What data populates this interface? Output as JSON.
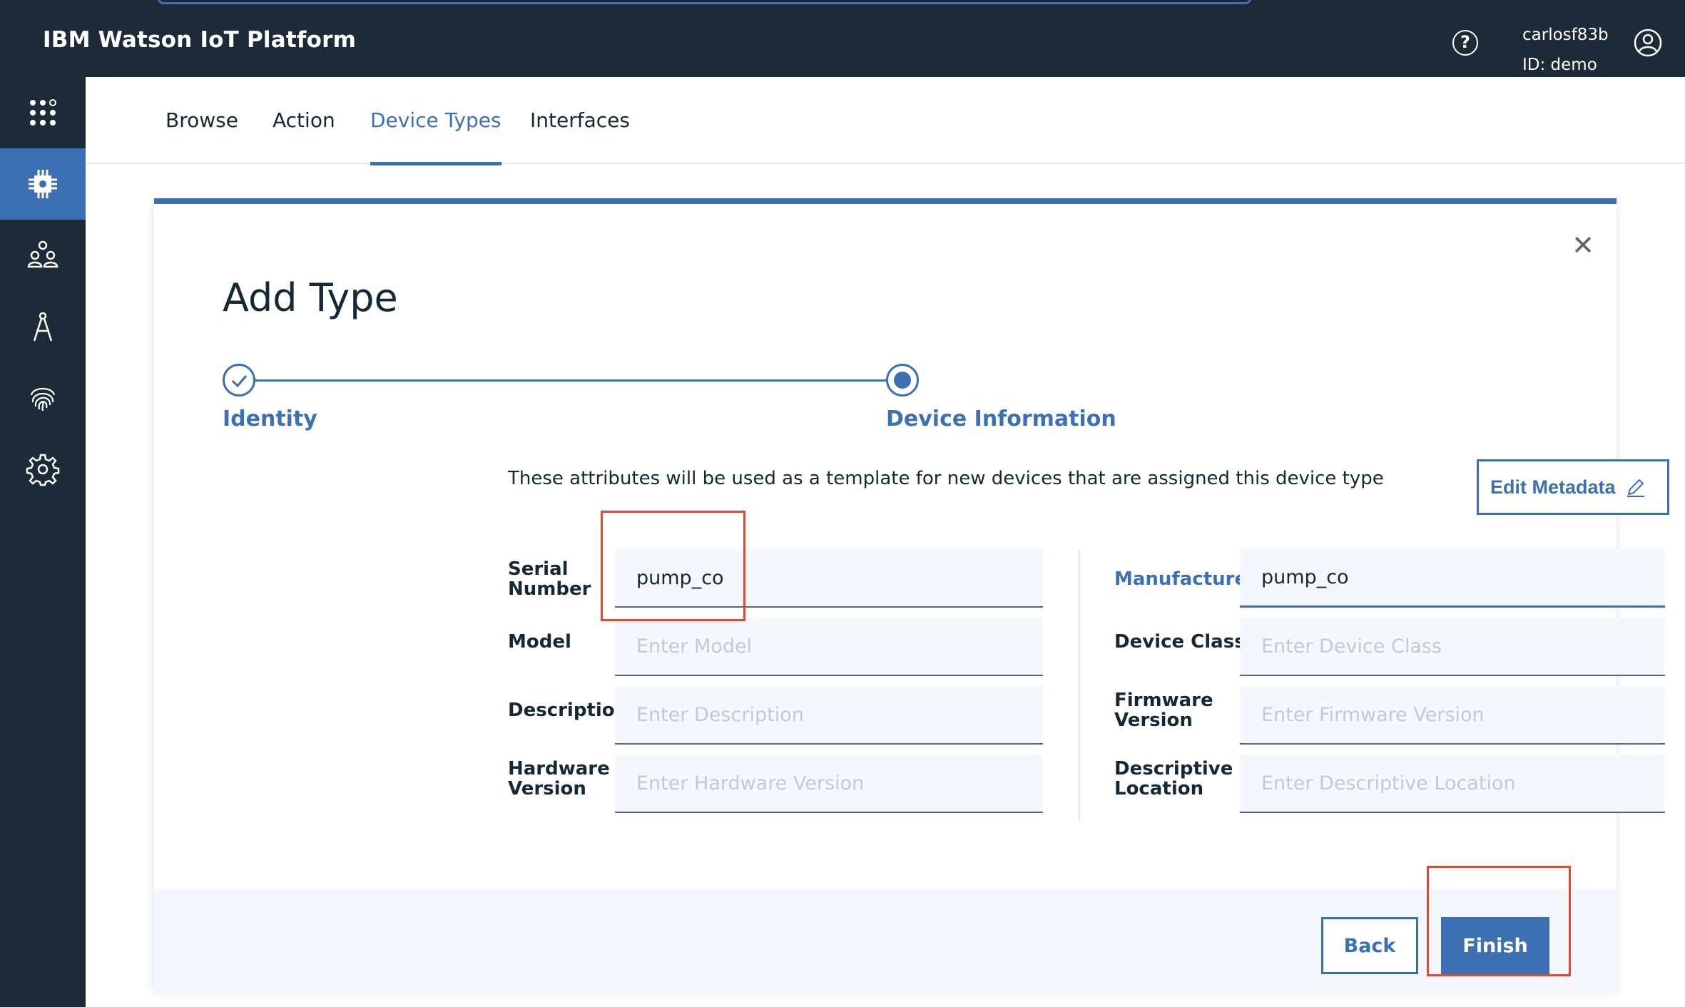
{
  "header": {
    "app_title": "IBM Watson IoT Platform",
    "help_icon": "question-circle-icon",
    "username": "carlosf83b",
    "org_id": "ID: demo",
    "user_icon": "user-circle-icon"
  },
  "rail": {
    "items": [
      {
        "icon": "app-grid-icon",
        "active": false
      },
      {
        "icon": "chip-icon",
        "active": true
      },
      {
        "icon": "members-icon",
        "active": false
      },
      {
        "icon": "compass-icon",
        "active": false
      },
      {
        "icon": "fingerprint-icon",
        "active": false
      },
      {
        "icon": "gear-icon",
        "active": false
      }
    ]
  },
  "tabs": [
    {
      "label": "Browse",
      "active": false
    },
    {
      "label": "Action",
      "active": false
    },
    {
      "label": "Device Types",
      "active": true
    },
    {
      "label": "Interfaces",
      "active": false
    }
  ],
  "modal": {
    "title": "Add Type",
    "close_glyph": "✕",
    "steps": [
      {
        "label": "Identity",
        "state": "complete"
      },
      {
        "label": "Device Information",
        "state": "current"
      }
    ],
    "helper_text": "These attributes will be used as a template for new devices that are assigned this device type",
    "edit_metadata_label": "Edit Metadata",
    "fields_left": [
      {
        "label_line1": "Serial",
        "label_line2": "Number",
        "value": "pump_co",
        "placeholder": ""
      },
      {
        "label_line1": "Model",
        "label_line2": "",
        "value": "",
        "placeholder": "Enter Model"
      },
      {
        "label_line1": "Description",
        "label_line2": "",
        "value": "",
        "placeholder": "Enter Description"
      },
      {
        "label_line1": "Hardware",
        "label_line2": "Version",
        "value": "",
        "placeholder": "Enter Hardware Version"
      }
    ],
    "fields_right": [
      {
        "label_line1": "Manufacturer",
        "label_line2": "",
        "value": "pump_co",
        "placeholder": ""
      },
      {
        "label_line1": "Device Class",
        "label_line2": "",
        "value": "",
        "placeholder": "Enter Device Class"
      },
      {
        "label_line1": "Firmware",
        "label_line2": "Version",
        "value": "",
        "placeholder": "Enter Firmware Version"
      },
      {
        "label_line1": "Descriptive",
        "label_line2": "Location",
        "value": "",
        "placeholder": "Enter Descriptive Location"
      }
    ],
    "back_label": "Back",
    "finish_label": "Finish"
  },
  "colors": {
    "header_bg": "#1d2a38",
    "accent": "#3d70b2",
    "highlight": "#e04a32",
    "input_bg": "#f4f7fb"
  }
}
